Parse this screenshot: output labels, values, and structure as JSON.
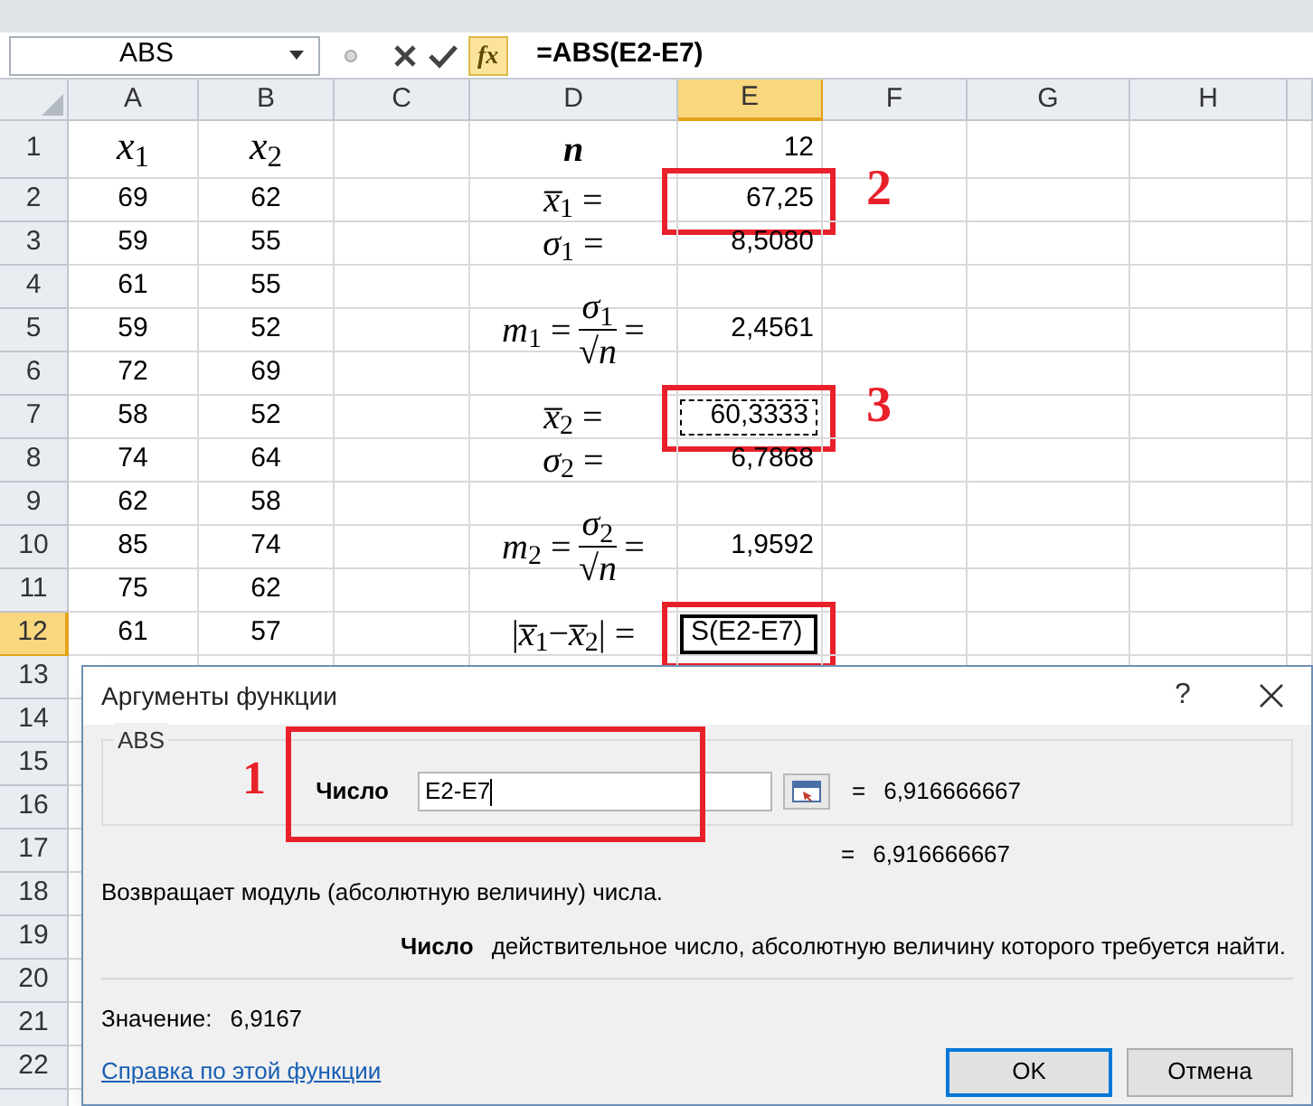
{
  "formula_bar": {
    "name_box": "ABS",
    "function_button": "fx",
    "formula": "=ABS(E2-E7)"
  },
  "columns": [
    {
      "label": "A",
      "selected": false
    },
    {
      "label": "B",
      "selected": false
    },
    {
      "label": "C",
      "selected": false
    },
    {
      "label": "D",
      "selected": false
    },
    {
      "label": "E",
      "selected": true
    },
    {
      "label": "F",
      "selected": false
    },
    {
      "label": "G",
      "selected": false
    },
    {
      "label": "H",
      "selected": false
    }
  ],
  "rows": [
    {
      "label": "1",
      "selected": false,
      "kind": "header",
      "a": "*x*$_{1}$",
      "b": "*x*$_{2}$",
      "d": {
        "kind": "symbol",
        "text": "n"
      },
      "e": {
        "value": "12",
        "editing": false,
        "copied": false,
        "boxed": false
      }
    },
    {
      "label": "2",
      "selected": false,
      "kind": "data",
      "a": "69",
      "b": "62",
      "d": {
        "kind": "equation",
        "text": "*x̅*$_{1}$ ="
      },
      "e": {
        "value": "67,25",
        "editing": false,
        "copied": false,
        "boxed": true,
        "note": "2"
      }
    },
    {
      "label": "3",
      "selected": false,
      "kind": "data",
      "a": "59",
      "b": "55",
      "d": {
        "kind": "equation",
        "text": "*σ*$_{1}$ ="
      },
      "e": {
        "value": "8,5080",
        "editing": false,
        "copied": false,
        "boxed": false
      }
    },
    {
      "label": "4",
      "selected": false,
      "kind": "data",
      "a": "61",
      "b": "55"
    },
    {
      "label": "5",
      "selected": false,
      "kind": "data",
      "a": "59",
      "b": "52",
      "d": {
        "kind": "fraction",
        "lhs": "*m*$_{1}$ =",
        "numerator": "*σ*$_{1}$",
        "denominator": "√*n*",
        "rhs": "="
      },
      "e": {
        "value": "2,4561",
        "editing": false,
        "copied": false,
        "boxed": false
      }
    },
    {
      "label": "6",
      "selected": false,
      "kind": "data",
      "a": "72",
      "b": "69"
    },
    {
      "label": "7",
      "selected": false,
      "kind": "data",
      "a": "58",
      "b": "52",
      "d": {
        "kind": "equation",
        "text": "*x̅*$_{2}$ ="
      },
      "e": {
        "value": "60,3333",
        "editing": false,
        "copied": true,
        "boxed": true,
        "note": "3"
      }
    },
    {
      "label": "8",
      "selected": false,
      "kind": "data",
      "a": "74",
      "b": "64",
      "d": {
        "kind": "equation",
        "text": "*σ*$_{2}$ ="
      },
      "e": {
        "value": "6,7868",
        "editing": false,
        "copied": false,
        "boxed": false
      }
    },
    {
      "label": "9",
      "selected": false,
      "kind": "data",
      "a": "62",
      "b": "58"
    },
    {
      "label": "10",
      "selected": false,
      "kind": "data",
      "a": "85",
      "b": "74",
      "d": {
        "kind": "fraction",
        "lhs": "*m*$_{2}$ =",
        "numerator": "*σ*$_{2}$",
        "denominator": "√*n*",
        "rhs": "="
      },
      "e": {
        "value": "1,9592",
        "editing": false,
        "copied": false,
        "boxed": false
      }
    },
    {
      "label": "11",
      "selected": false,
      "kind": "data",
      "a": "75",
      "b": "62"
    },
    {
      "label": "12",
      "selected": true,
      "kind": "data",
      "a": "61",
      "b": "57",
      "d": {
        "kind": "equation",
        "text": "|*x̅*$_{1}$−*x̅*$_{2}$| ="
      },
      "e": {
        "value": "S(E2-E7)",
        "editing": true,
        "copied": false,
        "boxed": true
      }
    },
    {
      "label": "13",
      "selected": false,
      "kind": "data"
    },
    {
      "label": "14",
      "selected": false,
      "kind": "data"
    },
    {
      "label": "15",
      "selected": false,
      "kind": "data"
    },
    {
      "label": "16",
      "selected": false,
      "kind": "data"
    },
    {
      "label": "17",
      "selected": false,
      "kind": "data"
    },
    {
      "label": "18",
      "selected": false,
      "kind": "data"
    },
    {
      "label": "19",
      "selected": false,
      "kind": "data"
    },
    {
      "label": "20",
      "selected": false,
      "kind": "data"
    },
    {
      "label": "21",
      "selected": false,
      "kind": "data"
    },
    {
      "label": "22",
      "selected": false,
      "kind": "data"
    }
  ],
  "dialog": {
    "title": "Аргументы функции",
    "help": "?",
    "function_name": "ABS",
    "annotation": "1",
    "argument": {
      "label": "Число",
      "value": "E2-E7",
      "sign": "=",
      "result": "6,916666667"
    },
    "formula_result": {
      "sign": "=",
      "value": "6,916666667"
    },
    "description": "Возвращает модуль (абсолютную величину) числа.",
    "argument_help": {
      "name": "Число",
      "text": "действительное число, абсолютную величину которого требуется найти."
    },
    "value_label": "Значение:",
    "value": "6,9167",
    "help_link": "Справка по этой функции",
    "buttons": [
      {
        "label": "OK",
        "default": true
      },
      {
        "label": "Отмена",
        "default": false
      }
    ]
  }
}
